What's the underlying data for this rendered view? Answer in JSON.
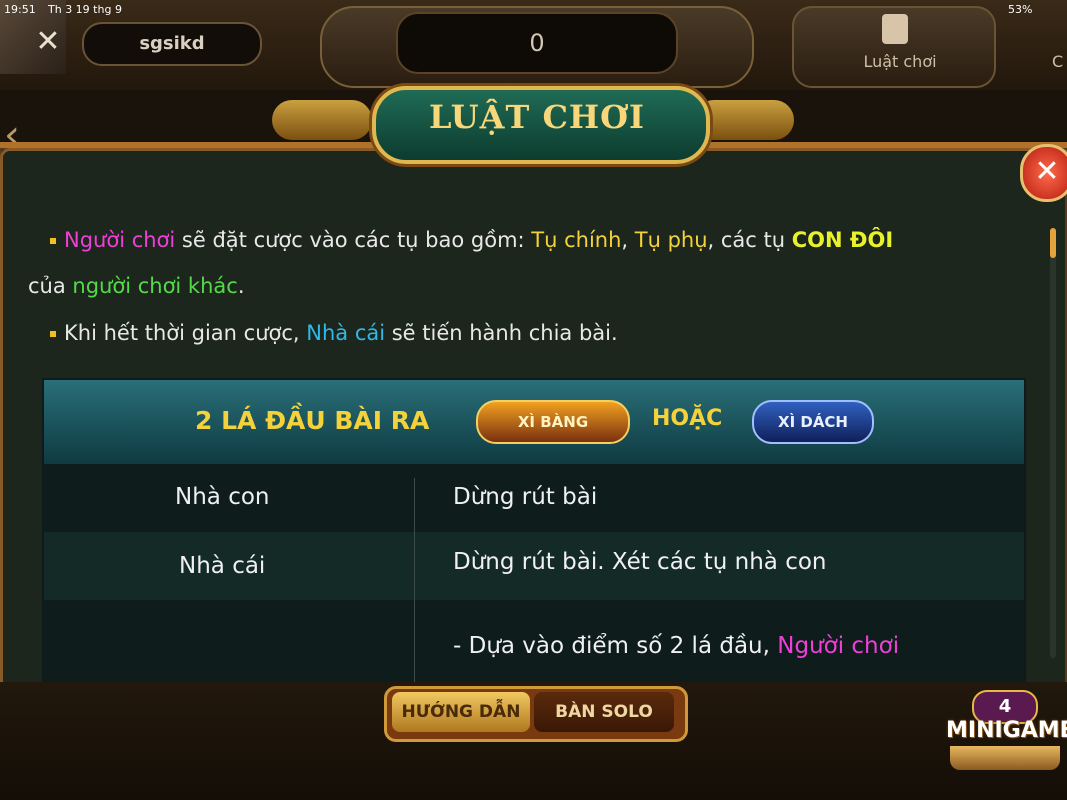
{
  "status": {
    "time": "19:51",
    "date": "Th 3 19 thg 9",
    "battery": "53%"
  },
  "header": {
    "username": "sgsikd",
    "balance": "0",
    "rules_label": "Luật chơi",
    "next_label": "C"
  },
  "modal": {
    "title": "LUẬT CHƠI",
    "close": "✕",
    "para1": {
      "a": "Người chơi",
      "b": " sẽ đặt cược vào các tụ bao gồm: ",
      "c": "Tụ chính",
      "d": ", ",
      "e": "Tụ phụ",
      "f": ", các tụ ",
      "g": "CON ĐÔI",
      "h": "của ",
      "i": "người chơi khác",
      "j": "."
    },
    "para2": {
      "a": "Khi hết thời gian cược, ",
      "b": "Nhà cái",
      "c": " sẽ tiến hành chia bài."
    },
    "table": {
      "header": "2 LÁ ĐẦU BÀI RA",
      "badge1": "XÌ BÀNG",
      "or": "HOẶC",
      "badge2": "XÌ DÁCH",
      "rows": [
        {
          "left": "Nhà con",
          "right": "Dừng rút bài"
        },
        {
          "left": "Nhà cái",
          "right": "Dừng rút bài. Xét các tụ nhà con"
        },
        {
          "left": "",
          "right_a": "- Dựa vào điểm số 2 lá đầu, ",
          "right_b": "Người chơi"
        }
      ]
    }
  },
  "tabs": {
    "guide": "HƯỚNG DẪN",
    "solo": "BÀN SOLO"
  },
  "minigame": {
    "count": "4",
    "label": "MINIGAME"
  }
}
